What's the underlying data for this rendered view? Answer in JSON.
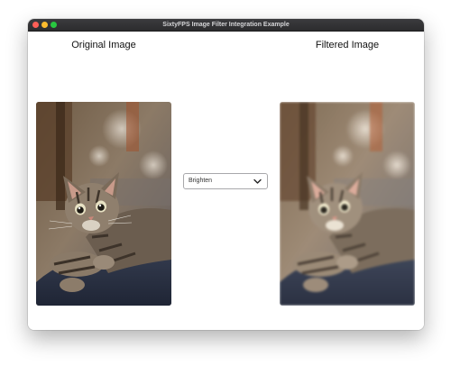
{
  "window": {
    "title": "SixtyFPS Image Filter Integration Example"
  },
  "captions": {
    "original": "Original Image",
    "filtered": "Filtered Image"
  },
  "filter_select": {
    "selected": "Brighten",
    "icon": "chevron-down-icon"
  },
  "colors": {
    "titlebar": "#2c2c2e",
    "close": "#ff5f57",
    "minimize": "#febc2e",
    "maximize": "#28c840"
  }
}
